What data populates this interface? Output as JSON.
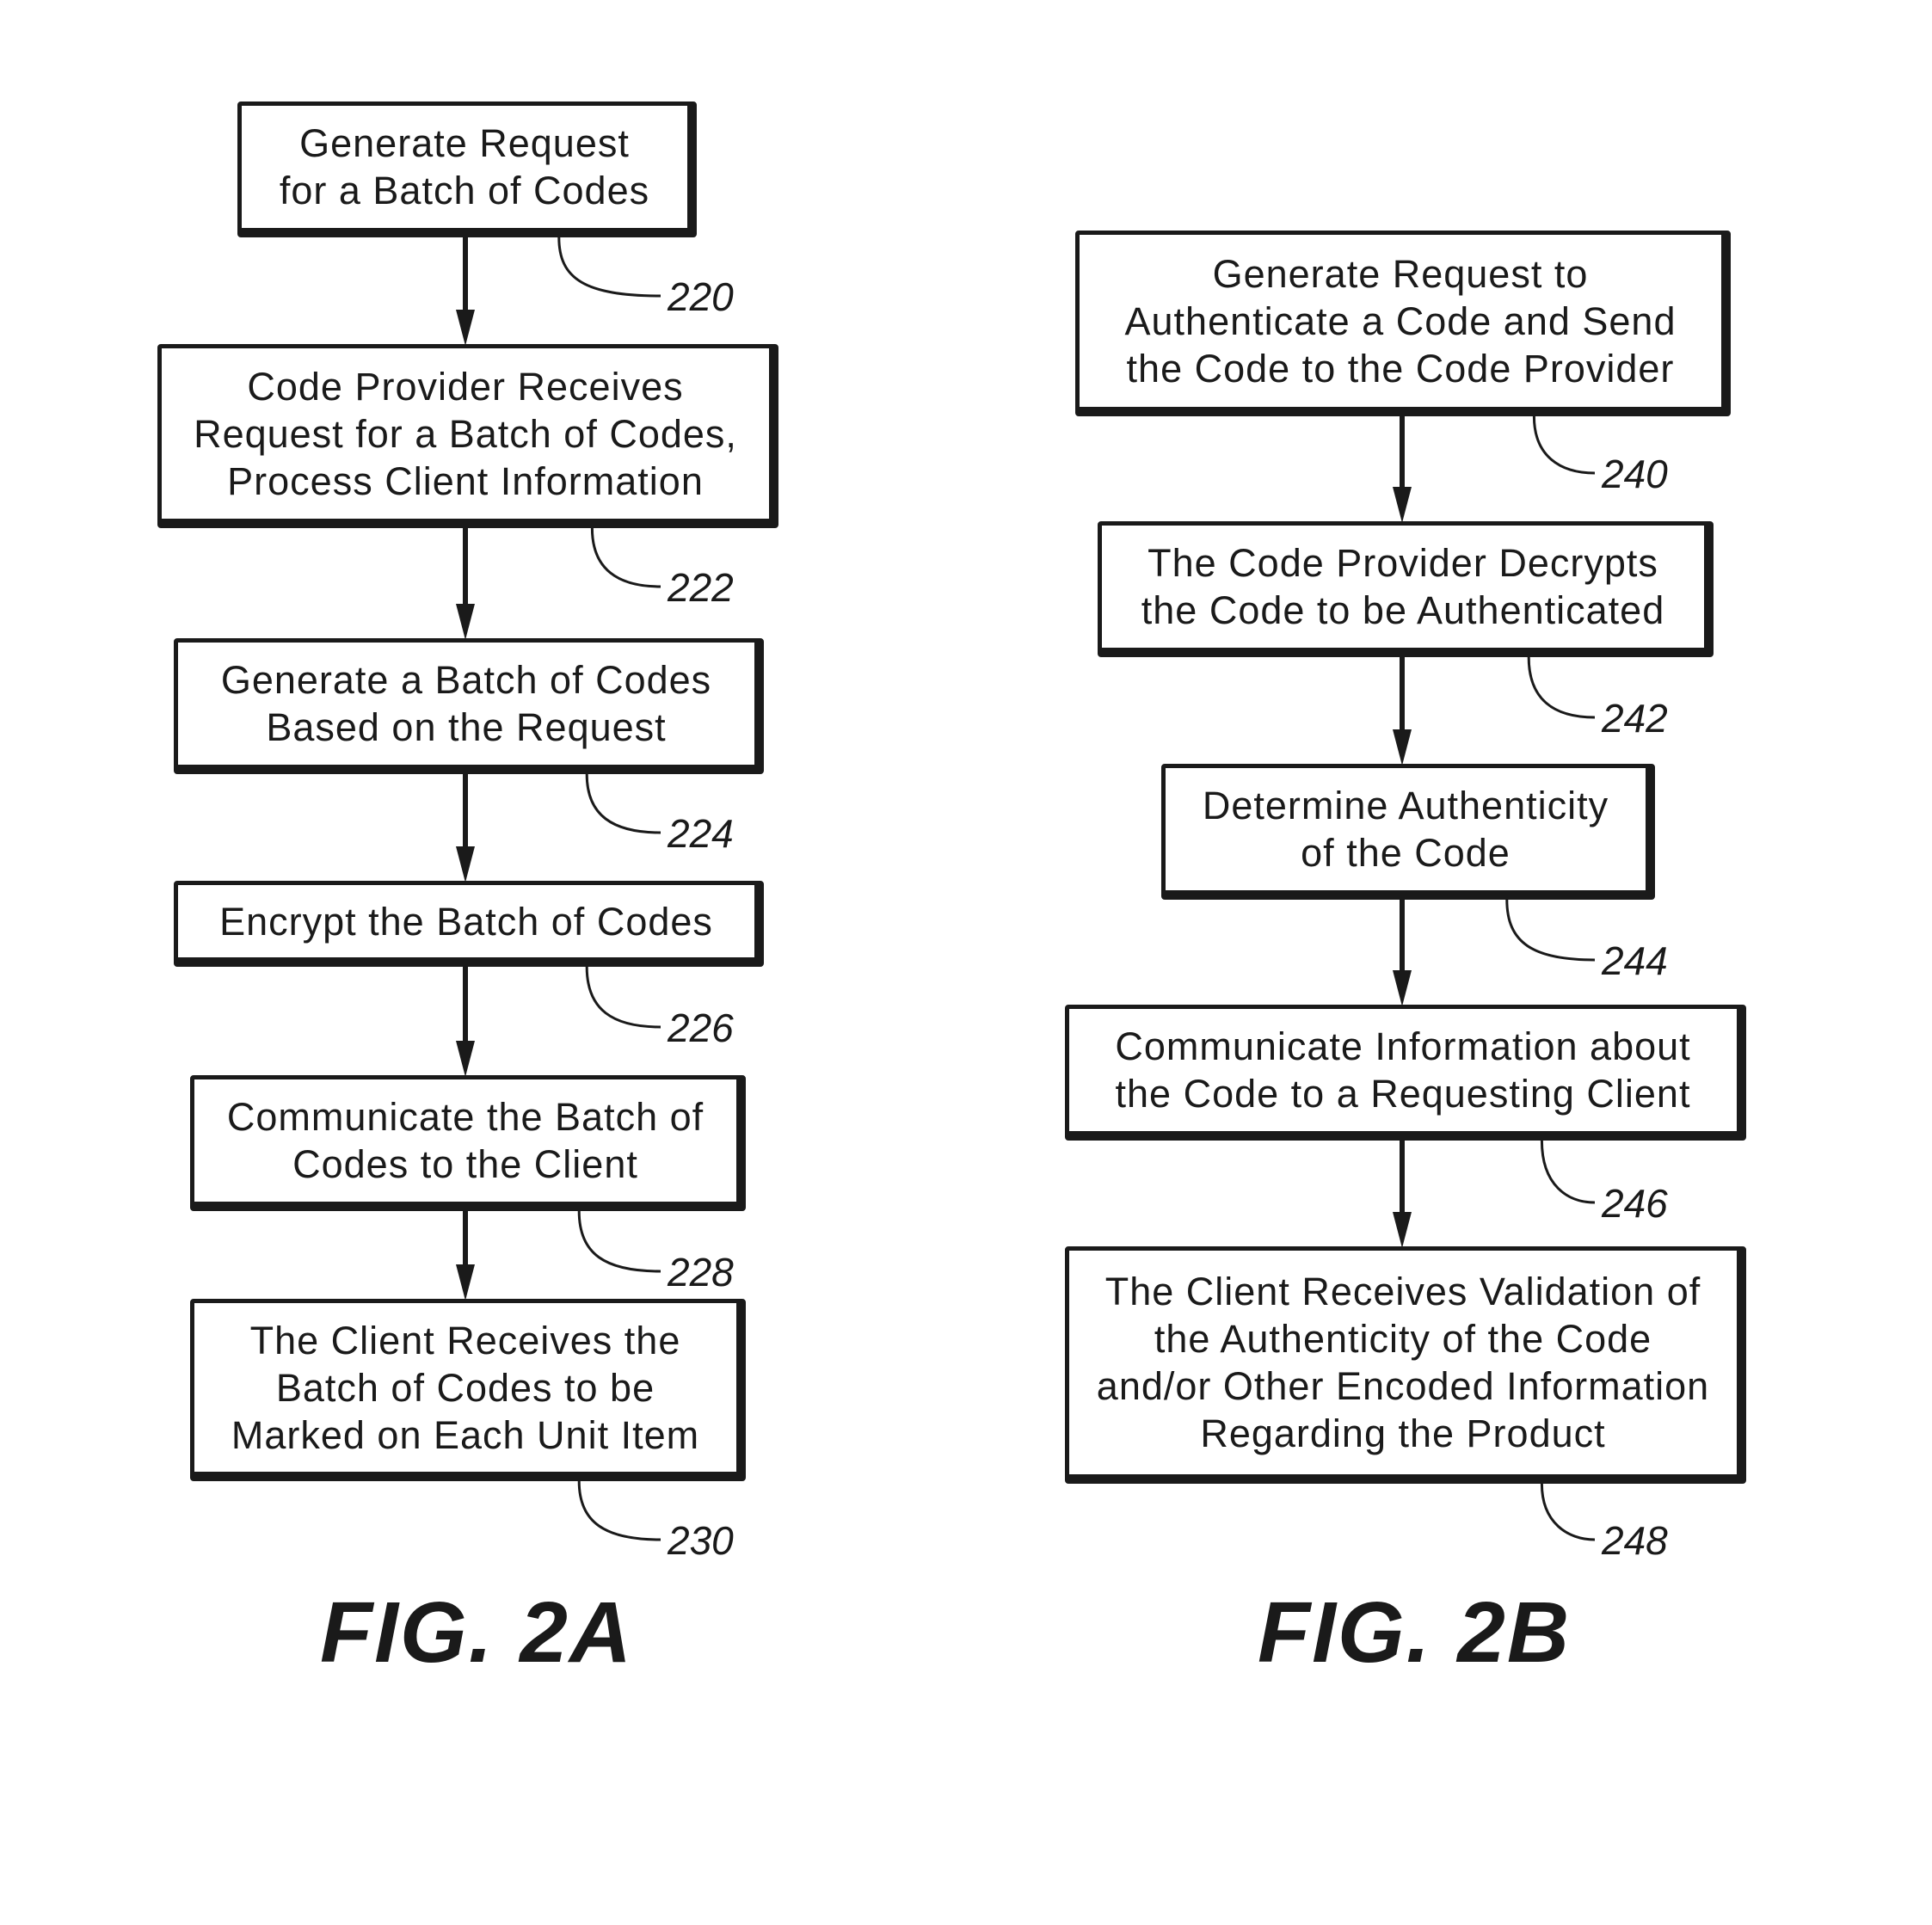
{
  "figures": [
    {
      "label": "FIG. 2A",
      "steps": [
        {
          "ref": "220",
          "text": "Generate Request\nfor a Batch of Codes"
        },
        {
          "ref": "222",
          "text": "Code Provider Receives\nRequest for a Batch of Codes,\nProcess Client Information"
        },
        {
          "ref": "224",
          "text": "Generate a Batch of Codes\nBased on the Request"
        },
        {
          "ref": "226",
          "text": "Encrypt the Batch of Codes"
        },
        {
          "ref": "228",
          "text": "Communicate the Batch of\nCodes to the Client"
        },
        {
          "ref": "230",
          "text": "The Client Receives the\nBatch of Codes to be\nMarked on Each Unit Item"
        }
      ]
    },
    {
      "label": "FIG. 2B",
      "steps": [
        {
          "ref": "240",
          "text": "Generate Request to\nAuthenticate a Code and Send\nthe Code to the Code Provider"
        },
        {
          "ref": "242",
          "text": "The Code Provider Decrypts\nthe Code to be Authenticated"
        },
        {
          "ref": "244",
          "text": "Determine Authenticity\nof the Code"
        },
        {
          "ref": "246",
          "text": "Communicate Information about\nthe Code to a Requesting Client"
        },
        {
          "ref": "248",
          "text": "The Client Receives Validation of\nthe Authenticity of the Code\nand/or Other Encoded Information\nRegarding the Product"
        }
      ]
    }
  ]
}
